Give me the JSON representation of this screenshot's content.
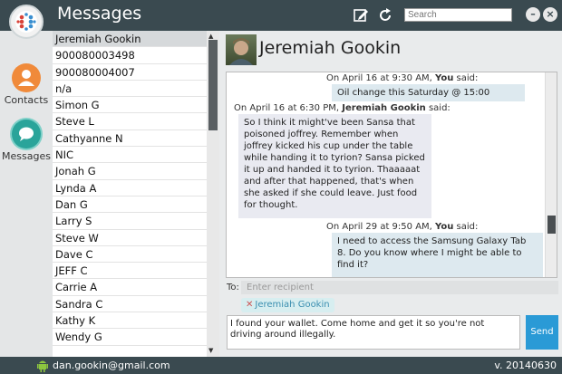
{
  "app": {
    "title": "Messages"
  },
  "search": {
    "placeholder": "Search"
  },
  "rail": [
    {
      "label": "Contacts"
    },
    {
      "label": "Messages"
    }
  ],
  "contacts": [
    "Jeremiah Gookin",
    "900080003498",
    "900080004007",
    "n/a",
    "Simon G",
    "Steve L",
    "Cathyanne N",
    "NIC",
    "Jonah G",
    "Lynda A",
    "Dan G",
    "Larry S",
    "Steve W",
    "Dave C",
    "JEFF C",
    "Carrie A",
    "Sandra C",
    "Kathy K",
    "Wendy G"
  ],
  "conversation": {
    "name": "Jeremiah Gookin",
    "messages": [
      {
        "meta_prefix": "On April 16 at 9:30 AM,",
        "sender": "You",
        "meta_suffix": "said:",
        "text": "Oil change this Saturday @ 15:00"
      },
      {
        "meta_prefix": "On April 16 at 6:30 PM,",
        "sender": "Jeremiah Gookin",
        "meta_suffix": "said:",
        "text": "So I think it might've been Sansa that poisoned joffrey. Remember when joffrey kicked his cup under the table while handing it to tyrion? Sansa picked it up and handed it to tyrion. Thaaaaat and after that happened, that's when she asked if she could leave. Just food for thought."
      },
      {
        "meta_prefix": "On April 29 at 9:50 AM,",
        "sender": "You",
        "meta_suffix": "said:",
        "text": "I need to access the Samsung Galaxy Tab 8. Do you know where I might be able to find it?"
      }
    ]
  },
  "compose": {
    "to_label": "To:",
    "to_placeholder": "Enter recipient",
    "recipient": "Jeremiah Gookin",
    "recipient_remove": "✕",
    "text": "I found your wallet. Come home and get it so  you're not driving around illegally.",
    "send_label": "Send"
  },
  "footer": {
    "email": "dan.gookin@gmail.com",
    "version": "v. 20140630"
  },
  "colors": {
    "header": "#3a4a50",
    "accent": "#2a9ad6",
    "contacts_icon": "#f08a3a",
    "messages_icon": "#2aa49a"
  }
}
